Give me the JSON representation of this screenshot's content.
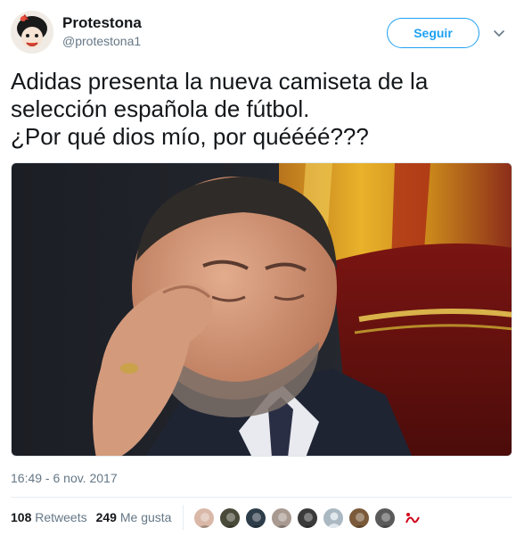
{
  "user": {
    "name": "Protestona",
    "handle": "@protestona1"
  },
  "follow_button": {
    "label": "Seguir"
  },
  "tweet": {
    "lines": [
      "Adidas presenta la nueva camiseta de la",
      "selección española de fútbol.",
      "¿Por qué dios mío, por quéééé???"
    ],
    "timestamp": "16:49 - 6 nov. 2017"
  },
  "stats": {
    "retweets_count": "108",
    "retweets_label": "Retweets",
    "likes_count": "249",
    "likes_label": "Me gusta"
  },
  "likers": [
    {
      "icon": "avatar-photo",
      "color": "#d9b8a8"
    },
    {
      "icon": "avatar-photo",
      "color": "#4a4a3a"
    },
    {
      "icon": "avatar-photo",
      "color": "#2e3d4a"
    },
    {
      "icon": "avatar-photo",
      "color": "#a89a90"
    },
    {
      "icon": "avatar-photo",
      "color": "#3a3a3a"
    },
    {
      "icon": "avatar-default",
      "color": "#aab8c2"
    },
    {
      "icon": "avatar-photo",
      "color": "#7a5a3a"
    },
    {
      "icon": "avatar-photo",
      "color": "#5a5a5a"
    },
    {
      "icon": "avatar-logo",
      "color": "#ffffff"
    }
  ],
  "colors": {
    "accent": "#1da1f2",
    "secondary_text": "#657786",
    "primary_text": "#14171a"
  }
}
